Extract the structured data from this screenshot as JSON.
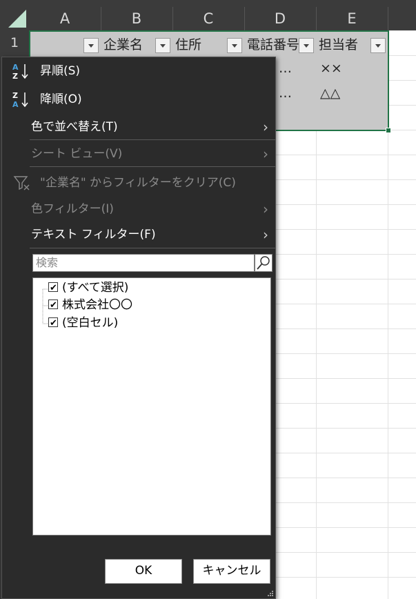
{
  "sheet": {
    "columns": [
      "A",
      "B",
      "C",
      "D",
      "E"
    ],
    "rows": [
      "1"
    ],
    "header_cells": [
      "",
      "企業名",
      "住所",
      "電話番号",
      "担当者"
    ],
    "data_cells": {
      "d2": "…",
      "e2": "××",
      "d3": "…",
      "e3": "△△"
    }
  },
  "menu": {
    "sort_asc": "昇順(S)",
    "sort_desc": "降順(O)",
    "sort_by_color": "色で並べ替え(T)",
    "sheet_view": "シート ビュー(V)",
    "clear_filter": "\"企業名\" からフィルターをクリア(C)",
    "color_filter": "色フィルター(I)",
    "text_filter": "テキスト フィルター(F)",
    "search_placeholder": "検索",
    "list_items": [
      "(すべて選択)",
      "株式会社〇〇",
      "(空白セル)"
    ],
    "ok": "OK",
    "cancel": "キャンセル"
  },
  "colors": {
    "menu_bg": "#2b2b2b",
    "selection_border": "#217346",
    "sort_icon_blue": "#4aa3e0"
  }
}
